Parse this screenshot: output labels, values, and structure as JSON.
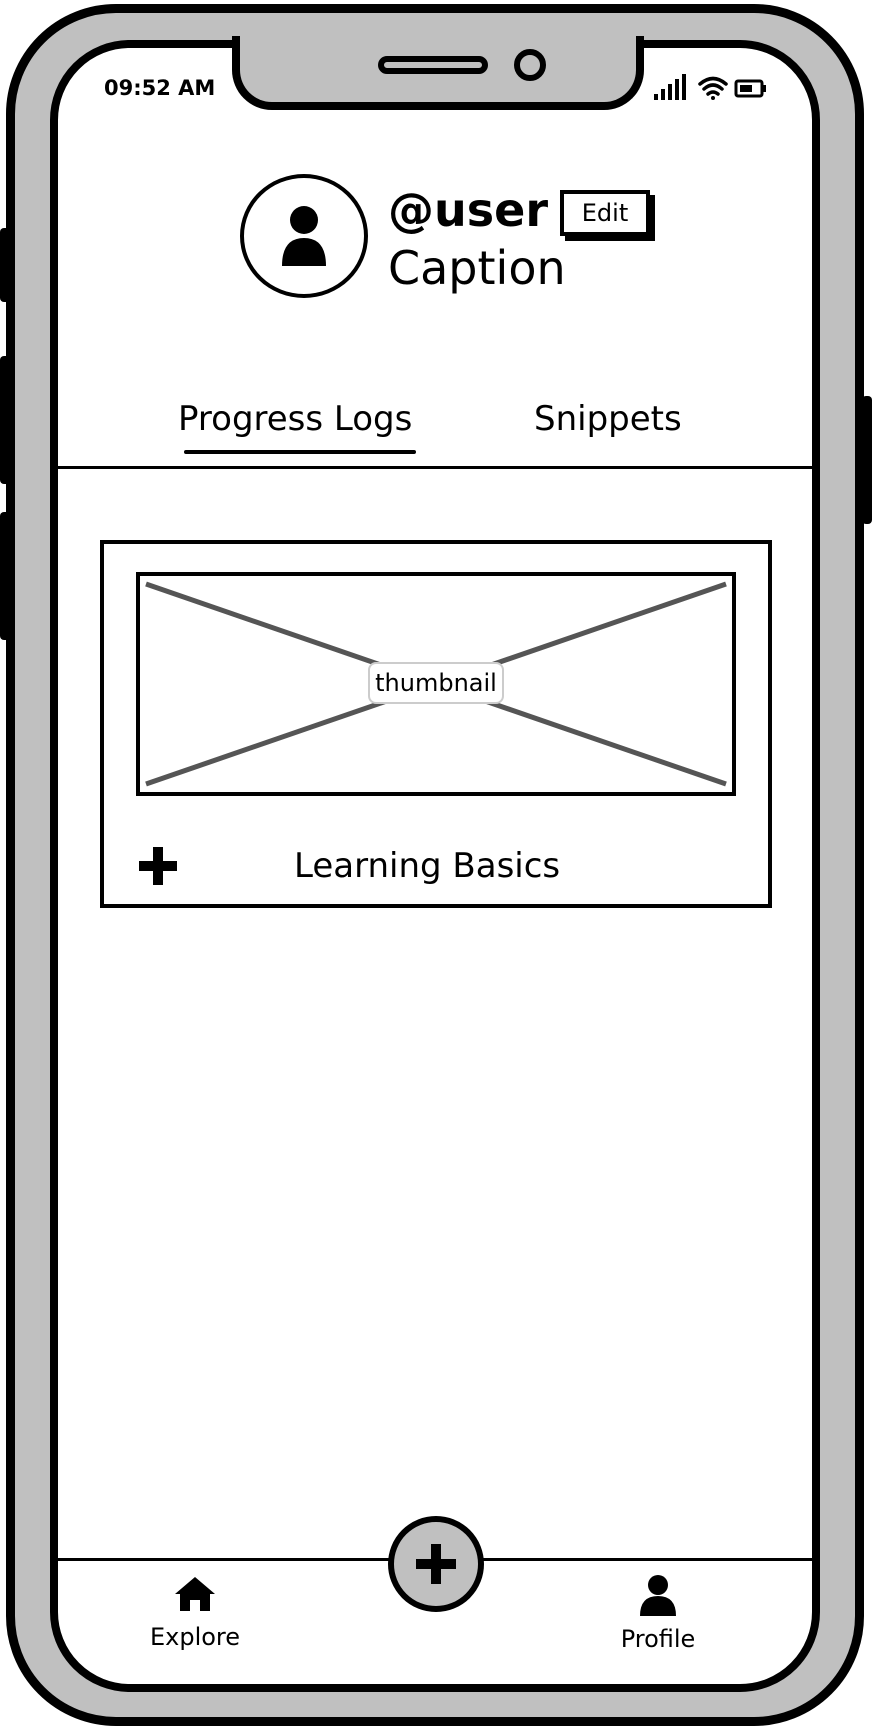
{
  "status_bar": {
    "time": "09:52 AM",
    "icons": [
      "signal-icon",
      "wifi-icon",
      "battery-icon"
    ]
  },
  "profile": {
    "handle": "@user",
    "caption": "Caption",
    "edit_label": "Edit",
    "avatar_icon": "user-icon"
  },
  "tabs": [
    {
      "label": "Progress Logs",
      "active": true
    },
    {
      "label": "Snippets",
      "active": false
    }
  ],
  "card": {
    "thumbnail_label": "thumbnail",
    "title": "Learning Basics",
    "add_icon": "plus-icon"
  },
  "bottom_nav": {
    "items": [
      {
        "label": "Explore",
        "icon": "home-icon"
      },
      {
        "label": "Profile",
        "icon": "user-icon"
      }
    ],
    "fab_icon": "plus-icon"
  },
  "colors": {
    "device_frame": "#c0c0c0",
    "outline": "#000000",
    "screen": "#ffffff",
    "placeholder_cross": "#555555"
  }
}
